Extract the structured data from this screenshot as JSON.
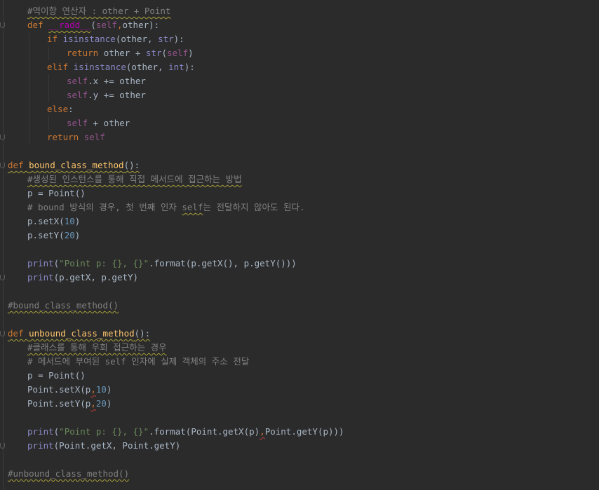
{
  "lines": [
    {
      "tokens": [
        {
          "t": "#역이항 연산자 : other + Point",
          "c": "cmt wavy"
        }
      ]
    },
    {
      "tokens": [
        {
          "t": "def",
          "c": "kw"
        },
        {
          "t": " ",
          "c": "txt"
        },
        {
          "t": "__radd__",
          "c": "dunder wavy"
        },
        {
          "t": "(",
          "c": "txt"
        },
        {
          "t": "self",
          "c": "self"
        },
        {
          "t": ",",
          "c": "kw"
        },
        {
          "t": "other",
          "c": "txt"
        },
        {
          "t": "):",
          "c": "txt"
        }
      ]
    },
    {
      "tokens": [
        {
          "t": "if ",
          "c": "kw"
        },
        {
          "t": "isinstance",
          "c": "bi"
        },
        {
          "t": "(other, ",
          "c": "txt"
        },
        {
          "t": "str",
          "c": "bi"
        },
        {
          "t": "):",
          "c": "txt"
        }
      ]
    },
    {
      "tokens": [
        {
          "t": "return ",
          "c": "kw"
        },
        {
          "t": "other + ",
          "c": "txt"
        },
        {
          "t": "str",
          "c": "bi"
        },
        {
          "t": "(",
          "c": "txt"
        },
        {
          "t": "self",
          "c": "self"
        },
        {
          "t": ")",
          "c": "txt"
        }
      ]
    },
    {
      "tokens": [
        {
          "t": "elif ",
          "c": "kw"
        },
        {
          "t": "isinstance",
          "c": "bi"
        },
        {
          "t": "(other, ",
          "c": "txt"
        },
        {
          "t": "int",
          "c": "bi"
        },
        {
          "t": "):",
          "c": "txt"
        }
      ]
    },
    {
      "tokens": [
        {
          "t": "self",
          "c": "self"
        },
        {
          "t": ".x += other",
          "c": "txt"
        }
      ]
    },
    {
      "tokens": [
        {
          "t": "self",
          "c": "self"
        },
        {
          "t": ".y += other",
          "c": "txt"
        }
      ]
    },
    {
      "tokens": [
        {
          "t": "else",
          "c": "kw"
        },
        {
          "t": ":",
          "c": "txt"
        }
      ]
    },
    {
      "tokens": [
        {
          "t": "self",
          "c": "self"
        },
        {
          "t": " + other",
          "c": "txt"
        }
      ]
    },
    {
      "tokens": [
        {
          "t": "return ",
          "c": "kw"
        },
        {
          "t": "self",
          "c": "self"
        }
      ]
    },
    {
      "tokens": []
    },
    {
      "tokens": [
        {
          "t": "def ",
          "c": "kw wavy"
        },
        {
          "t": "bound_class_method",
          "c": "fn wavy"
        },
        {
          "t": "():",
          "c": "txt wavy"
        }
      ]
    },
    {
      "tokens": [
        {
          "t": "#생성된 인스턴스를 통해 직접 메서드에 접근하는 방법",
          "c": "cmt wavy"
        }
      ]
    },
    {
      "tokens": [
        {
          "t": "p = Point()",
          "c": "txt"
        }
      ]
    },
    {
      "tokens": [
        {
          "t": "# bound 방식의 경우, 첫 번째 인자 ",
          "c": "cmt"
        },
        {
          "t": "self",
          "c": "cmt wavy"
        },
        {
          "t": "는 전달하지 않아도 된다.",
          "c": "cmt"
        }
      ]
    },
    {
      "tokens": [
        {
          "t": "p.setX(",
          "c": "txt"
        },
        {
          "t": "10",
          "c": "num"
        },
        {
          "t": ")",
          "c": "txt"
        }
      ]
    },
    {
      "tokens": [
        {
          "t": "p.setY(",
          "c": "txt"
        },
        {
          "t": "20",
          "c": "num"
        },
        {
          "t": ")",
          "c": "txt"
        }
      ]
    },
    {
      "tokens": []
    },
    {
      "tokens": [
        {
          "t": "print",
          "c": "bi"
        },
        {
          "t": "(",
          "c": "txt"
        },
        {
          "t": "\"Point p: {}, {}\"",
          "c": "str"
        },
        {
          "t": ".format(p.getX(), p.getY()))",
          "c": "txt"
        }
      ]
    },
    {
      "tokens": [
        {
          "t": "print",
          "c": "bi"
        },
        {
          "t": "(p.getX, p.getY)",
          "c": "txt"
        }
      ]
    },
    {
      "tokens": []
    },
    {
      "tokens": [
        {
          "t": "#bound_class_method()",
          "c": "cmt wavy"
        }
      ]
    },
    {
      "tokens": []
    },
    {
      "tokens": [
        {
          "t": "def ",
          "c": "kw wavy"
        },
        {
          "t": "unbound_class_method",
          "c": "fn wavy"
        },
        {
          "t": "():",
          "c": "txt wavy"
        }
      ]
    },
    {
      "tokens": [
        {
          "t": "#클래스를 통해 우회 접근하는 경우",
          "c": "cmt wavy"
        }
      ]
    },
    {
      "tokens": [
        {
          "t": "# 메서드에 부여된 self 인자에 실제 객체의 주소 전달",
          "c": "cmt"
        }
      ]
    },
    {
      "tokens": [
        {
          "t": "p = Point()",
          "c": "txt"
        }
      ]
    },
    {
      "tokens": [
        {
          "t": "Point.setX(p",
          "c": "txt"
        },
        {
          "t": ",",
          "c": "kw wavy-red"
        },
        {
          "t": "10",
          "c": "num"
        },
        {
          "t": ")",
          "c": "txt"
        }
      ]
    },
    {
      "tokens": [
        {
          "t": "Point.setY(p",
          "c": "txt"
        },
        {
          "t": ",",
          "c": "kw wavy-red"
        },
        {
          "t": "20",
          "c": "num"
        },
        {
          "t": ")",
          "c": "txt"
        }
      ]
    },
    {
      "tokens": []
    },
    {
      "tokens": [
        {
          "t": "print",
          "c": "bi"
        },
        {
          "t": "(",
          "c": "txt"
        },
        {
          "t": "\"Point p: {}, {}\"",
          "c": "str"
        },
        {
          "t": ".format(Point.getX(p)",
          "c": "txt"
        },
        {
          "t": ",",
          "c": "kw wavy-red"
        },
        {
          "t": "Point.getY(p)))",
          "c": "txt"
        }
      ]
    },
    {
      "tokens": [
        {
          "t": "print",
          "c": "bi"
        },
        {
          "t": "(Point.getX, Point.getY)",
          "c": "txt"
        }
      ]
    },
    {
      "tokens": []
    },
    {
      "tokens": [
        {
          "t": "#unbound_class_method()",
          "c": "cmt wavy"
        }
      ]
    }
  ]
}
